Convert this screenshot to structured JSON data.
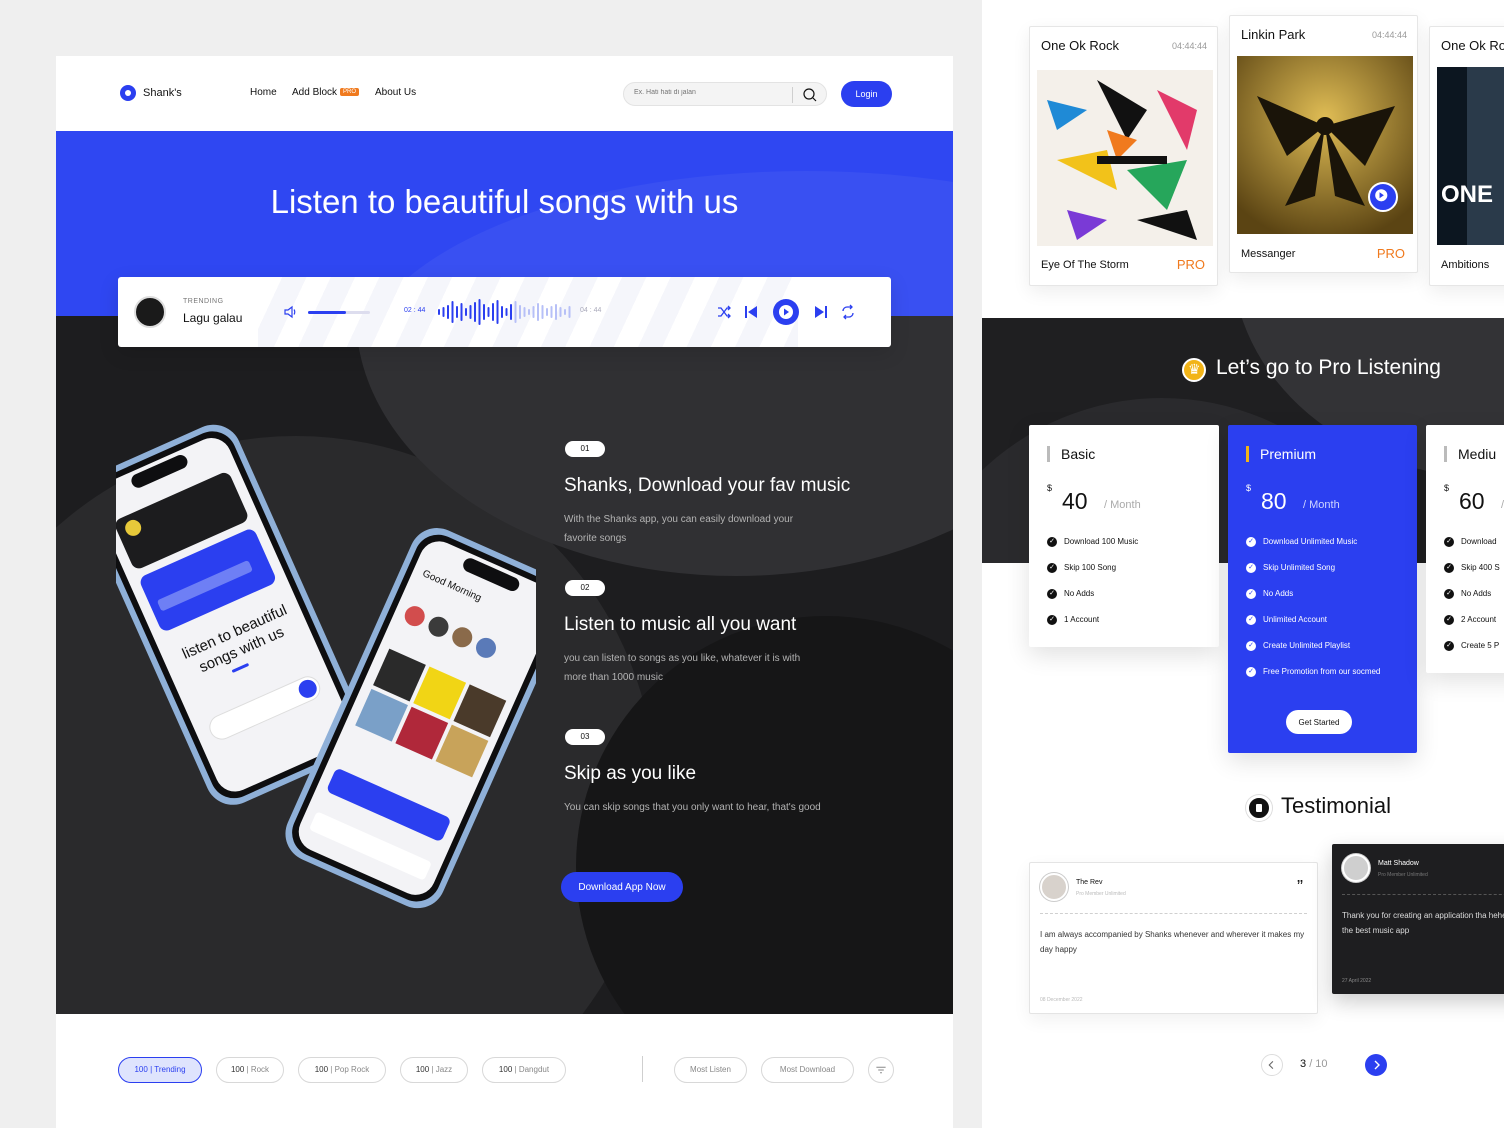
{
  "nav": {
    "logo": "Shank's",
    "links": [
      "Home",
      "Add Block",
      "About Us"
    ],
    "pro_tag": "PRO",
    "search_placeholder": "Ex. Hati hati di jalan",
    "login": "Login"
  },
  "hero": {
    "title": "Listen to beautiful songs with us"
  },
  "player": {
    "trending": "TRENDING",
    "song": "Lagu galau",
    "elapsed": "02 : 44",
    "total": "04 : 44",
    "volume_level": 0.62
  },
  "features": [
    {
      "num": "01",
      "title": "Shanks, Download your fav music",
      "desc": "With the Shanks app, you can easily download your favorite songs"
    },
    {
      "num": "02",
      "title": "Listen to music all you want",
      "desc": "you can listen to songs as you like, whatever it is with more than 1000 music"
    },
    {
      "num": "03",
      "title": "Skip as you like",
      "desc": "You can skip songs that you only want to hear, that's good"
    }
  ],
  "download_button": "Download App Now",
  "filters": {
    "chips": [
      {
        "count": "100",
        "label": "Trending",
        "active": true
      },
      {
        "count": "100",
        "label": "Rock",
        "active": false
      },
      {
        "count": "100",
        "label": "Pop Rock",
        "active": false
      },
      {
        "count": "100",
        "label": "Jazz",
        "active": false
      },
      {
        "count": "100",
        "label": "Dangdut",
        "active": false
      }
    ],
    "sort": [
      "Most Listen",
      "Most Download"
    ]
  },
  "albums": [
    {
      "artist": "One Ok Rock",
      "time": "04:44:44",
      "song": "Eye Of The Storm",
      "badge": "PRO"
    },
    {
      "artist": "Linkin Park",
      "time": "04:44:44",
      "song": "Messanger",
      "badge": "PRO"
    },
    {
      "artist": "One Ok Ro",
      "song": "Ambitions"
    }
  ],
  "pro": {
    "title": "Let’s go to Pro Listening",
    "plans": [
      {
        "name": "Basic",
        "currency": "$",
        "price": "40",
        "per": "/ Month",
        "features": [
          "Download 100 Music",
          "Skip 100 Song",
          "No Adds",
          "1 Account"
        ]
      },
      {
        "name": "Premium",
        "currency": "$",
        "price": "80",
        "per": "/ Month",
        "features": [
          "Download Unlimited Music",
          "Skip Unlimited Song",
          "No Adds",
          "Unlimited Account",
          "Create Unlimited Playlist",
          "Free Promotion from our socmed"
        ],
        "button": "Get Started"
      },
      {
        "name": "Mediu",
        "currency": "$",
        "price": "60",
        "per": "/",
        "features": [
          "Download",
          "Skip 400 S",
          "No Adds",
          "2 Account",
          "Create 5 P"
        ]
      }
    ]
  },
  "testimonial": {
    "title": "Testimonial",
    "items": [
      {
        "name": "The Rev",
        "role": "Pro Member Unlimited",
        "quote_mark": "”",
        "text": "I am always accompanied by Shanks whenever and wherever it makes my day happy",
        "date": "08 December 2022"
      },
      {
        "name": "Matt Shadow",
        "role": "Pro Member Unlimited",
        "text": "Thank you for creating an application tha hehehehe, the best music app",
        "date": "27 April 2022"
      }
    ],
    "pagination": {
      "current": "3",
      "total": "/ 10"
    }
  },
  "colors": {
    "accent": "#2b3ff0",
    "pro_orange": "#f07a1e",
    "crown_gold": "#f2b418",
    "dark": "#1d1d1f"
  }
}
